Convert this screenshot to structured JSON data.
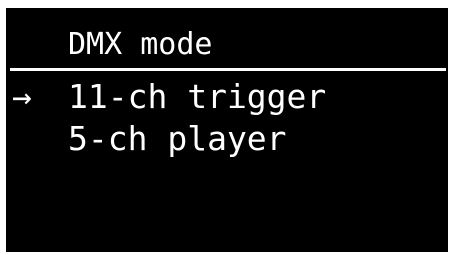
{
  "screen": {
    "title": "DMX mode",
    "background_color": "#000000",
    "text_color": "#ffffff"
  },
  "menu": {
    "cursor_symbol": "→",
    "selected_index": 0,
    "items": [
      {
        "label": "11-ch trigger",
        "selected": true
      },
      {
        "label": "5-ch player",
        "selected": false
      }
    ]
  }
}
